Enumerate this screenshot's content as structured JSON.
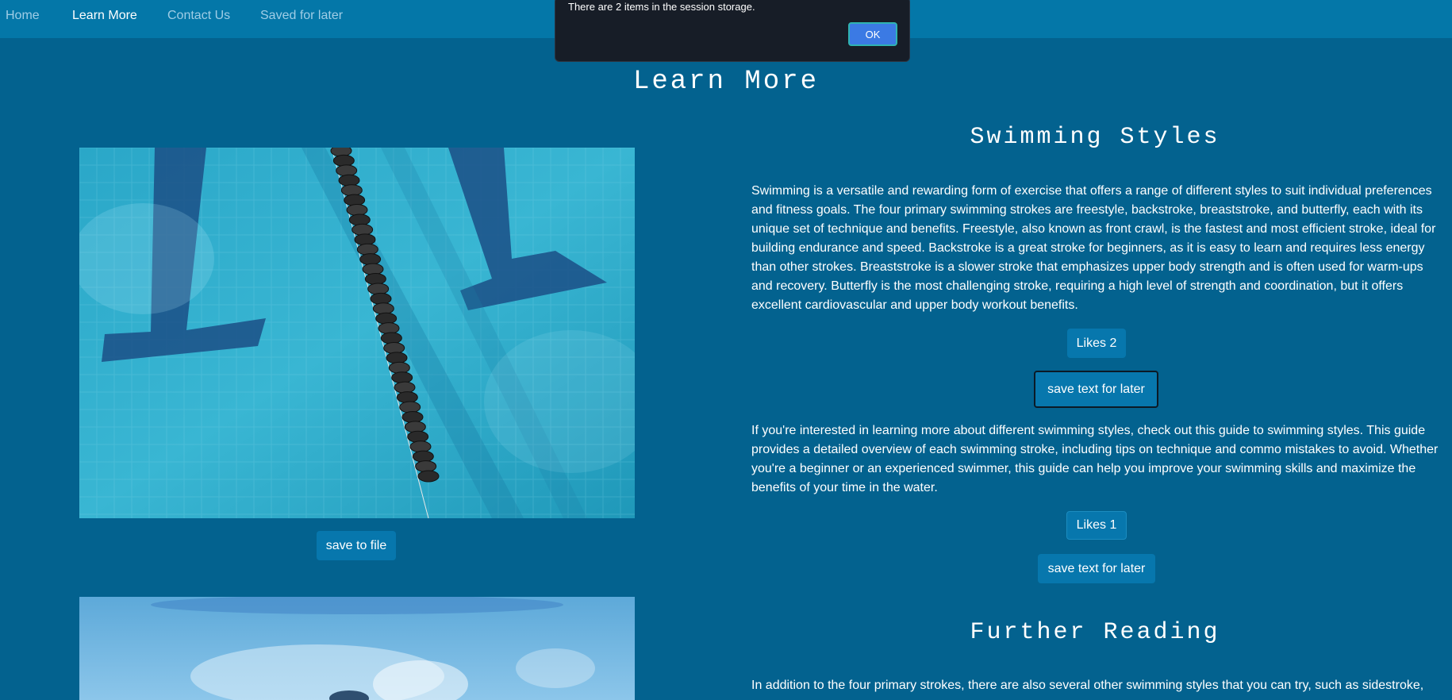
{
  "nav": {
    "home": "Home",
    "learn_more": "Learn More",
    "contact_us": "Contact Us",
    "saved_for_later": "Saved for later"
  },
  "dialog": {
    "message": "There are 2 items in the session storage.",
    "ok_label": "OK"
  },
  "page_title": "Learn More",
  "left": {
    "save_to_file_label": "save to file"
  },
  "swimming_styles": {
    "heading": "Swimming Styles",
    "paragraph1": "Swimming is a versatile and rewarding form of exercise that offers a range of different styles to suit individual preferences and fitness goals. The four primary swimming strokes are freestyle, backstroke, breaststroke, and butterfly, each with its unique set of technique and benefits. Freestyle, also known as front crawl, is the fastest and most efficient stroke, ideal for building endurance and speed. Backstroke is a great stroke for beginners, as it is easy to learn and requires less energy than other strokes. Breaststroke is a slower stroke that emphasizes upper body strength and is often used for warm-ups and recovery. Butterfly is the most challenging stroke, requiring a high level of strength and coordination, but it offers excellent cardiovascular and upper body workout benefits.",
    "likes1_label": "Likes 2",
    "save_text1_label": "save text for later",
    "paragraph2": "If you're interested in learning more about different swimming styles, check out this guide to swimming styles. This guide provides a detailed overview of each swimming stroke, including tips on technique and commo mistakes to avoid. Whether you're a beginner or an experienced swimmer, this guide can help you improve your swimming skills and maximize the benefits of your time in the water.",
    "likes2_label": "Likes 1",
    "save_text2_label": "save text for later"
  },
  "further_reading": {
    "heading": "Further Reading",
    "paragraph": "In addition to the four primary strokes, there are also several other swimming styles that you can try, such as sidestroke,"
  },
  "colors": {
    "background": "#03628f",
    "navbar": "#0477a8",
    "button": "#0777ad",
    "dialog": "#171d27",
    "dialog_button": "#3b7ae4"
  }
}
